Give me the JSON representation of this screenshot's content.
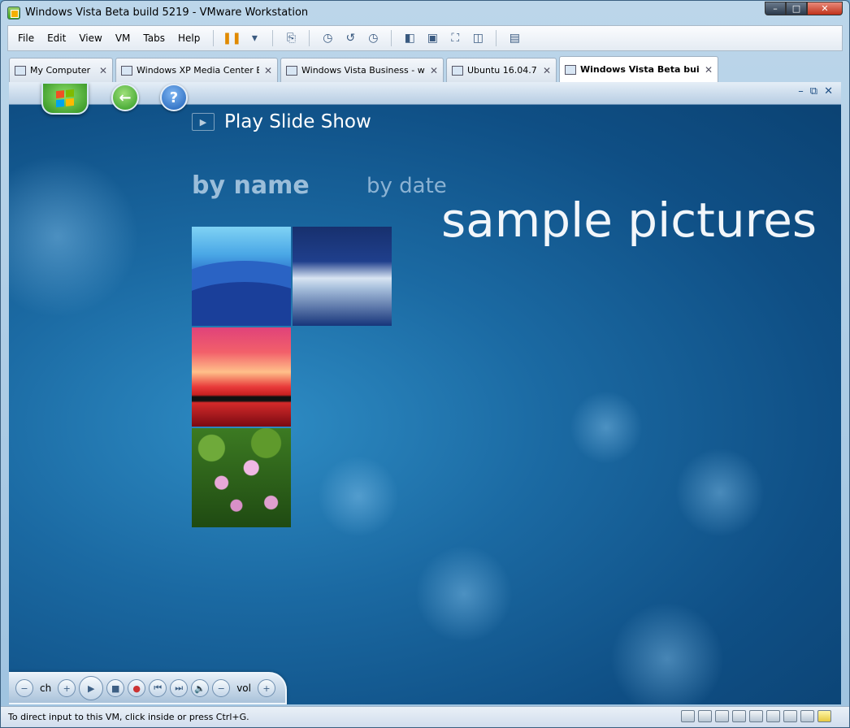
{
  "window": {
    "title": "Windows Vista Beta build 5219 - VMware Workstation",
    "controls": {
      "minimize": "–",
      "maximize": "□",
      "close": "✕"
    }
  },
  "menubar": {
    "items": [
      "File",
      "Edit",
      "View",
      "VM",
      "Tabs",
      "Help"
    ],
    "toolbar_icons": [
      "pause-icon",
      "dropdown-icon",
      "send-ctrl-alt-del-icon",
      "snapshot-take-icon",
      "snapshot-revert-icon",
      "snapshot-manager-icon",
      "sidebar-icon",
      "console-view-icon",
      "fullscreen-icon",
      "unity-icon",
      "thumbnail-view-icon"
    ]
  },
  "tabs": [
    {
      "label": "My Computer",
      "active": false
    },
    {
      "label": "Windows XP Media Center Edi...",
      "active": false
    },
    {
      "label": "Windows Vista Business - with...",
      "active": false
    },
    {
      "label": "Ubuntu 16.04.7",
      "active": false
    },
    {
      "label": "Windows Vista Beta build ...",
      "active": true
    }
  ],
  "media_center": {
    "play_slideshow": "Play Slide Show",
    "sort_by_name": "by name",
    "sort_by_date": "by date",
    "gallery_title": "sample pictures",
    "thumbnails": [
      "blue-hills",
      "winter",
      "sunset",
      "water-lilies"
    ],
    "transport": {
      "ch_label": "ch",
      "vol_label": "vol"
    }
  },
  "statusbar": {
    "text": "To direct input to this VM, click inside or press Ctrl+G."
  }
}
